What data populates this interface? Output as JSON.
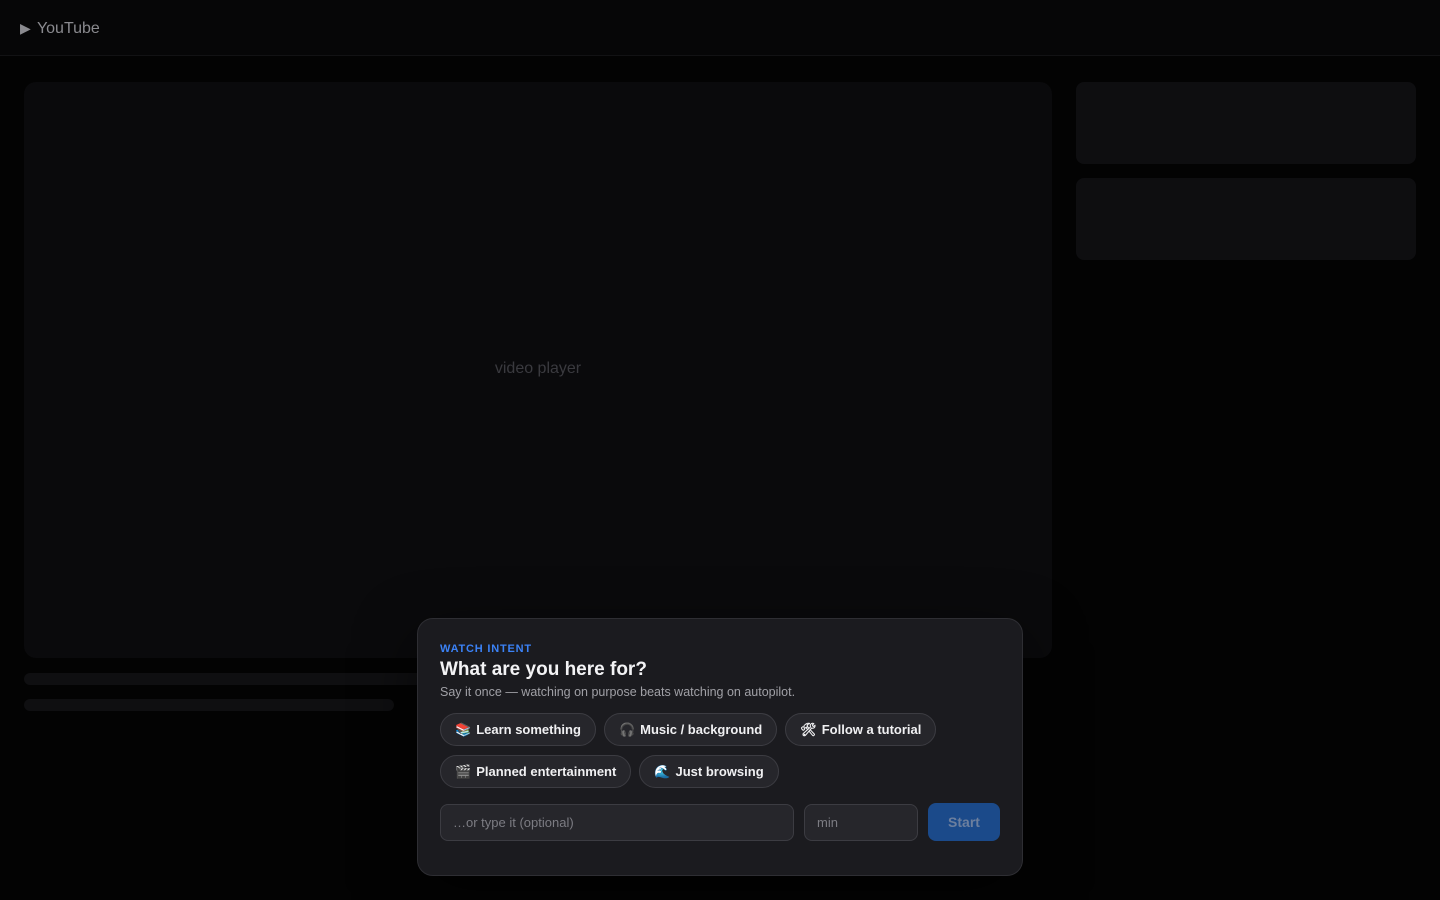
{
  "header": {
    "logo_icon": "play-icon",
    "logo_glyph": "▶",
    "logo_text": "YouTube"
  },
  "player": {
    "label": "video player"
  },
  "modal": {
    "eyebrow": "WATCH INTENT",
    "title": "What are you here for?",
    "subtitle": "Say it once — watching on purpose beats watching on autopilot.",
    "chips": [
      {
        "emoji": "📚",
        "icon": "books-icon",
        "label": "Learn something"
      },
      {
        "emoji": "🎧",
        "icon": "headphones-icon",
        "label": "Music / background"
      },
      {
        "emoji": "🛠",
        "icon": "tools-icon",
        "label": "Follow a tutorial"
      },
      {
        "emoji": "🎬",
        "icon": "clapper-icon",
        "label": "Planned entertainment"
      },
      {
        "emoji": "🌊",
        "icon": "wave-icon",
        "label": "Just browsing"
      }
    ],
    "intent_input": {
      "value": "",
      "placeholder": "…or type it (optional)"
    },
    "minutes_input": {
      "value": "",
      "placeholder": "min"
    },
    "start_label": "Start"
  },
  "colors": {
    "accent": "#3b82f6",
    "start_button": "#1b4a8a",
    "background": "#030303",
    "modal_background": "#1b1b1f"
  }
}
